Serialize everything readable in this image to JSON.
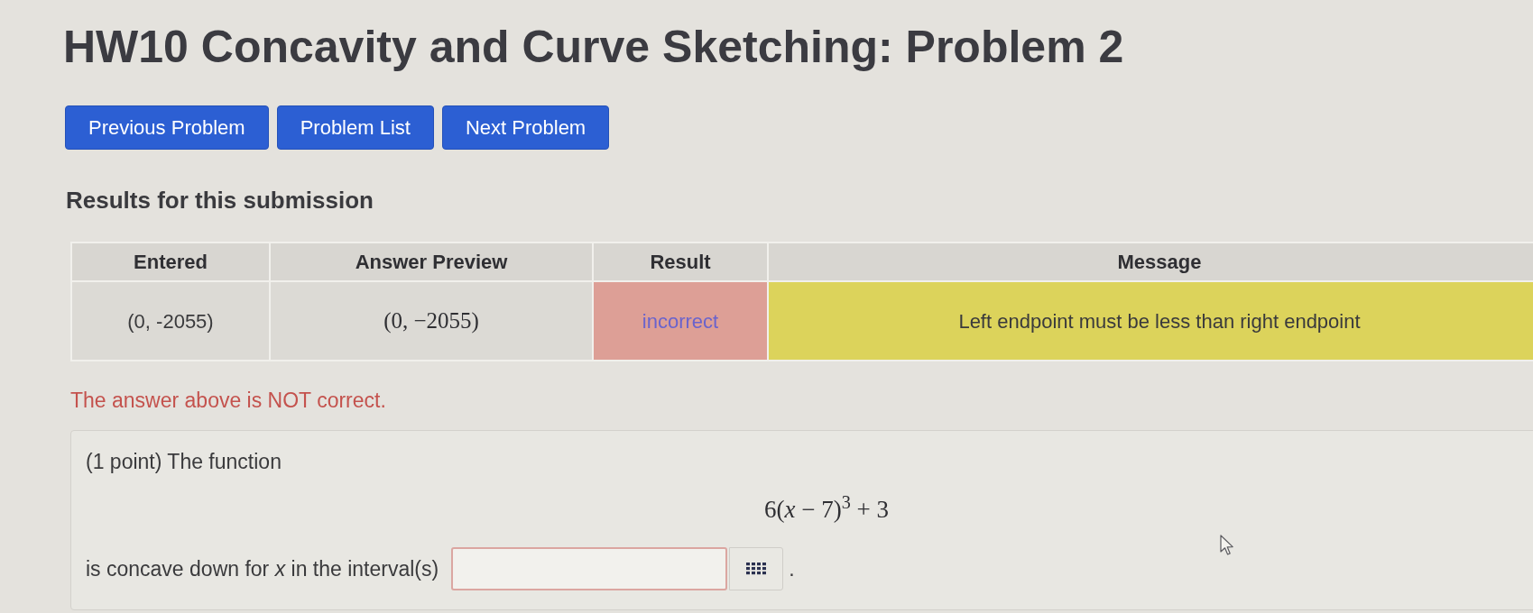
{
  "title": "HW10 Concavity and Curve Sketching: Problem 2",
  "nav_buttons": [
    "Previous Problem",
    "Problem List",
    "Next Problem"
  ],
  "results": {
    "heading": "Results for this submission",
    "columns": [
      "Entered",
      "Answer Preview",
      "Result",
      "Message"
    ],
    "rows": [
      {
        "entered": "(0, -2055)",
        "answer_preview": "(0, −2055)",
        "result": "incorrect",
        "correct": false,
        "message": "Left endpoint must be less than right endpoint"
      }
    ]
  },
  "status": {
    "text": "The answer above is NOT correct.",
    "correct": false
  },
  "problem": {
    "intro": "(1 point) The function",
    "formula": "6(*x* − 7)$^{3}$ + 3",
    "prompt": "is concave down for *x* in the interval(s)",
    "answer_field": {
      "incorrect": true
    },
    "after_field": "."
  }
}
